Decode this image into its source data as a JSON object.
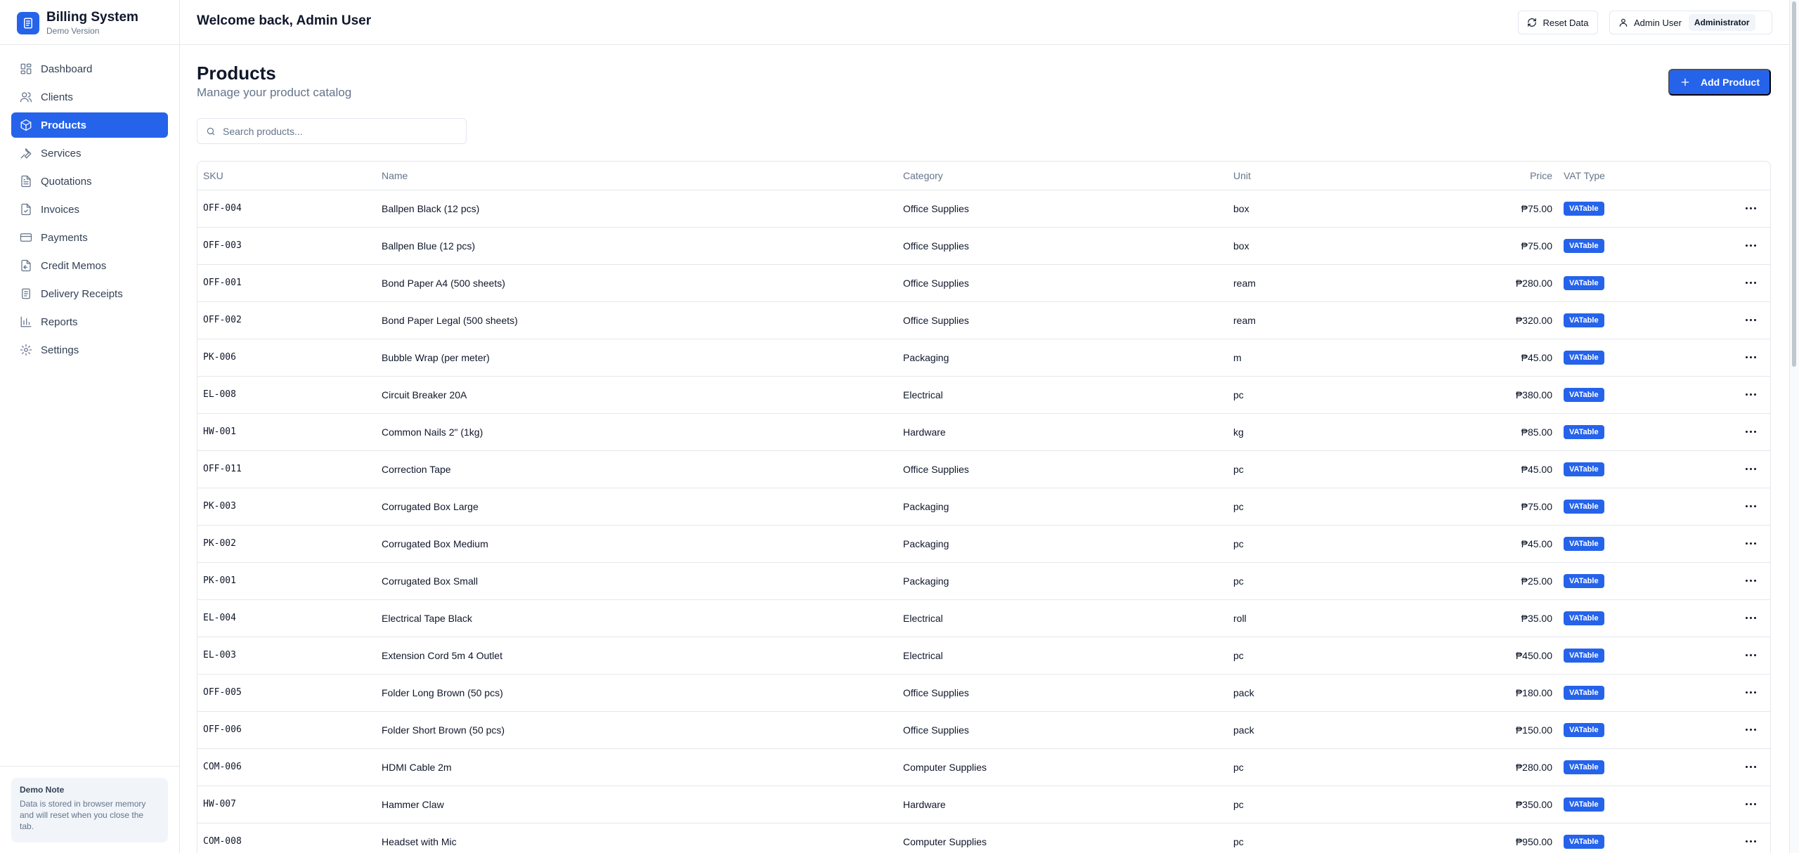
{
  "brand": {
    "title": "Billing System",
    "subtitle": "Demo Version",
    "icon": "receipt-icon"
  },
  "nav": [
    {
      "label": "Dashboard",
      "icon": "dashboard-icon",
      "active": false
    },
    {
      "label": "Clients",
      "icon": "users-icon",
      "active": false
    },
    {
      "label": "Products",
      "icon": "package-icon",
      "active": true
    },
    {
      "label": "Services",
      "icon": "wrench-icon",
      "active": false
    },
    {
      "label": "Quotations",
      "icon": "file-text-icon",
      "active": false
    },
    {
      "label": "Invoices",
      "icon": "file-check-icon",
      "active": false
    },
    {
      "label": "Payments",
      "icon": "credit-card-icon",
      "active": false
    },
    {
      "label": "Credit Memos",
      "icon": "file-return-icon",
      "active": false
    },
    {
      "label": "Delivery Receipts",
      "icon": "receipt-icon",
      "active": false
    },
    {
      "label": "Reports",
      "icon": "bar-chart-icon",
      "active": false
    },
    {
      "label": "Settings",
      "icon": "gear-icon",
      "active": false
    }
  ],
  "demo_note": {
    "title": "Demo Note",
    "text": "Data is stored in browser memory and will reset when you close the tab."
  },
  "topbar": {
    "welcome": "Welcome back, Admin User",
    "reset_label": "Reset Data",
    "user_name": "Admin User",
    "role": "Administrator"
  },
  "page": {
    "title": "Products",
    "subtitle": "Manage your product catalog",
    "add_label": "Add Product",
    "search_placeholder": "Search products...",
    "search_value": ""
  },
  "colors": {
    "accent": "#2563eb",
    "border": "#e5e7eb",
    "muted": "#64748b"
  },
  "table": {
    "columns": [
      "SKU",
      "Name",
      "Category",
      "Unit",
      "Price",
      "VAT Type"
    ],
    "rows": [
      {
        "sku": "OFF-004",
        "name": "Ballpen Black (12 pcs)",
        "category": "Office Supplies",
        "unit": "box",
        "price": "₱75.00",
        "vat": "VATable"
      },
      {
        "sku": "OFF-003",
        "name": "Ballpen Blue (12 pcs)",
        "category": "Office Supplies",
        "unit": "box",
        "price": "₱75.00",
        "vat": "VATable"
      },
      {
        "sku": "OFF-001",
        "name": "Bond Paper A4 (500 sheets)",
        "category": "Office Supplies",
        "unit": "ream",
        "price": "₱280.00",
        "vat": "VATable"
      },
      {
        "sku": "OFF-002",
        "name": "Bond Paper Legal (500 sheets)",
        "category": "Office Supplies",
        "unit": "ream",
        "price": "₱320.00",
        "vat": "VATable"
      },
      {
        "sku": "PK-006",
        "name": "Bubble Wrap (per meter)",
        "category": "Packaging",
        "unit": "m",
        "price": "₱45.00",
        "vat": "VATable"
      },
      {
        "sku": "EL-008",
        "name": "Circuit Breaker 20A",
        "category": "Electrical",
        "unit": "pc",
        "price": "₱380.00",
        "vat": "VATable"
      },
      {
        "sku": "HW-001",
        "name": "Common Nails 2\" (1kg)",
        "category": "Hardware",
        "unit": "kg",
        "price": "₱85.00",
        "vat": "VATable"
      },
      {
        "sku": "OFF-011",
        "name": "Correction Tape",
        "category": "Office Supplies",
        "unit": "pc",
        "price": "₱45.00",
        "vat": "VATable"
      },
      {
        "sku": "PK-003",
        "name": "Corrugated Box Large",
        "category": "Packaging",
        "unit": "pc",
        "price": "₱75.00",
        "vat": "VATable"
      },
      {
        "sku": "PK-002",
        "name": "Corrugated Box Medium",
        "category": "Packaging",
        "unit": "pc",
        "price": "₱45.00",
        "vat": "VATable"
      },
      {
        "sku": "PK-001",
        "name": "Corrugated Box Small",
        "category": "Packaging",
        "unit": "pc",
        "price": "₱25.00",
        "vat": "VATable"
      },
      {
        "sku": "EL-004",
        "name": "Electrical Tape Black",
        "category": "Electrical",
        "unit": "roll",
        "price": "₱35.00",
        "vat": "VATable"
      },
      {
        "sku": "EL-003",
        "name": "Extension Cord 5m 4 Outlet",
        "category": "Electrical",
        "unit": "pc",
        "price": "₱450.00",
        "vat": "VATable"
      },
      {
        "sku": "OFF-005",
        "name": "Folder Long Brown (50 pcs)",
        "category": "Office Supplies",
        "unit": "pack",
        "price": "₱180.00",
        "vat": "VATable"
      },
      {
        "sku": "OFF-006",
        "name": "Folder Short Brown (50 pcs)",
        "category": "Office Supplies",
        "unit": "pack",
        "price": "₱150.00",
        "vat": "VATable"
      },
      {
        "sku": "COM-006",
        "name": "HDMI Cable 2m",
        "category": "Computer Supplies",
        "unit": "pc",
        "price": "₱280.00",
        "vat": "VATable"
      },
      {
        "sku": "HW-007",
        "name": "Hammer Claw",
        "category": "Hardware",
        "unit": "pc",
        "price": "₱350.00",
        "vat": "VATable"
      },
      {
        "sku": "COM-008",
        "name": "Headset with Mic",
        "category": "Computer Supplies",
        "unit": "pc",
        "price": "₱950.00",
        "vat": "VATable"
      }
    ]
  }
}
